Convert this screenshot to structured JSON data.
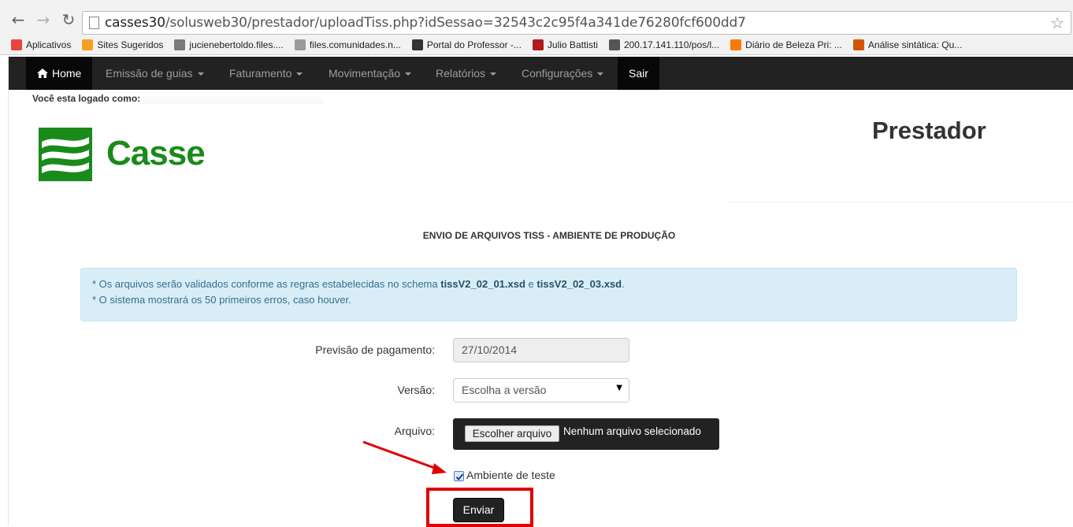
{
  "browser": {
    "url_host": "casses30",
    "url_path": "/solusweb30/prestador/uploadTiss.php?idSessao=32543c2c95f4a341de76280fcf600dd7",
    "bookmarks": [
      {
        "label": "Aplicativos",
        "icon": "apps-grid-icon",
        "color": "#e8453c"
      },
      {
        "label": "Sites Sugeridos",
        "icon": "suggested-sites-icon",
        "color": "#f4a020"
      },
      {
        "label": "jucienebertoldo.files....",
        "icon": "globe-icon",
        "color": "#7a7a7a"
      },
      {
        "label": "files.comunidades.n...",
        "icon": "page-icon",
        "color": "#9a9a9a"
      },
      {
        "label": "Portal do Professor -...",
        "icon": "graduation-cap-icon",
        "color": "#333333"
      },
      {
        "label": "Julio Battisti",
        "icon": "jb-logo-icon",
        "color": "#b01c1c"
      },
      {
        "label": "200.17.141.110/pos/l...",
        "icon": "building-icon",
        "color": "#555555"
      },
      {
        "label": "Diário de Beleza Pri: ...",
        "icon": "blogger-icon",
        "color": "#f57d00"
      },
      {
        "label": "Análise sintática: Qu...",
        "icon": "orange-globe-icon",
        "color": "#d35400"
      }
    ]
  },
  "navbar": {
    "home": "Home",
    "items": [
      "Emissão de guias",
      "Faturamento",
      "Movimentação",
      "Relatórios",
      "Configurações"
    ],
    "logout": "Sair"
  },
  "header": {
    "logged_label": "Você esta logado como:",
    "logo_text": "Casse",
    "section_title": "Prestador",
    "brand_color": "#1a8a1a"
  },
  "main": {
    "page_title": "ENVIO DE ARQUIVOS TISS - AMBIENTE DE PRODUÇÃO",
    "info_line1_pre": "* Os arquivos serão validados conforme as regras estabelecidas no schema ",
    "info_schema1": "tissV2_02_01.xsd",
    "info_mid": " e ",
    "info_schema2": "tissV2_02_03.xsd",
    "info_end": ".",
    "info_line2": "* O sistema mostrará os 50 primeiros erros, caso houver.",
    "payment_label": "Previsão de pagamento:",
    "payment_value": "27/10/2014",
    "version_label": "Versão:",
    "version_selected": "Escolha a versão",
    "file_label": "Arquivo:",
    "file_button": "Escolher arquivo",
    "file_status": "Nenhum arquivo selecionado",
    "test_env_label": "Ambiente de teste",
    "test_env_checked": true,
    "submit": "Enviar"
  },
  "annotation_color": "#e00000"
}
